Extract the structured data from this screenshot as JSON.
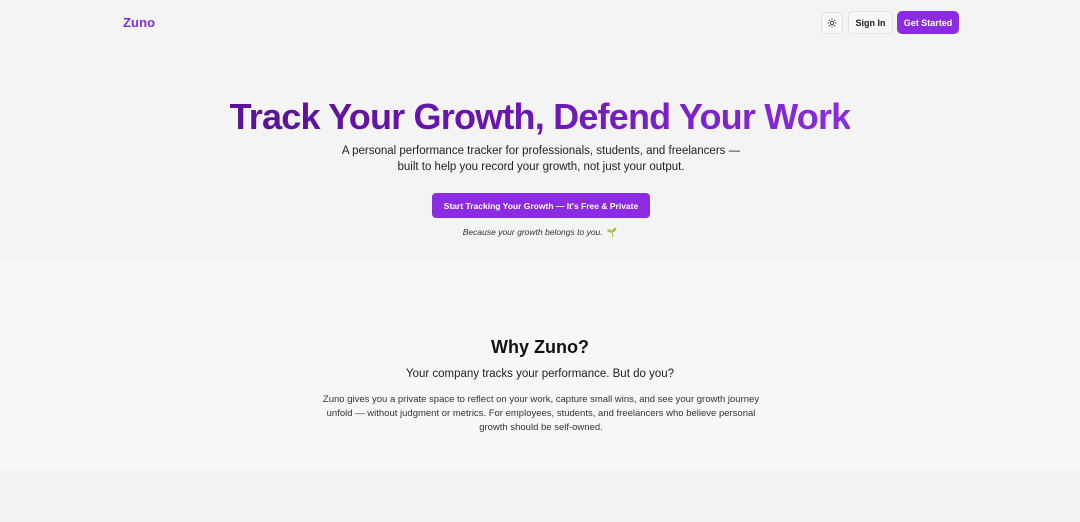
{
  "header": {
    "logo": "Zuno",
    "theme_icon": "sun-icon",
    "sign_in_label": "Sign In",
    "get_started_label": "Get Started"
  },
  "hero": {
    "title": "Track Your Growth, Defend Your Work",
    "subtitle": "A personal performance tracker for professionals, students, and freelancers — built to help you record your growth, not just your output.",
    "cta_label": "Start Tracking Your Growth — It's Free & Private",
    "tagline": "Because your growth belongs to you.",
    "tagline_emoji": "🌱"
  },
  "why": {
    "title": "Why Zuno?",
    "subtitle": "Your company tracks your performance. But do you?",
    "body": "Zuno gives you a private space to reflect on your work, capture small wins, and see your growth journey unfold — without judgment or metrics. For employees, students, and freelancers who believe personal growth should be self-owned."
  },
  "colors": {
    "brand": "#8b2be2",
    "brand_dark": "#5a1199"
  }
}
